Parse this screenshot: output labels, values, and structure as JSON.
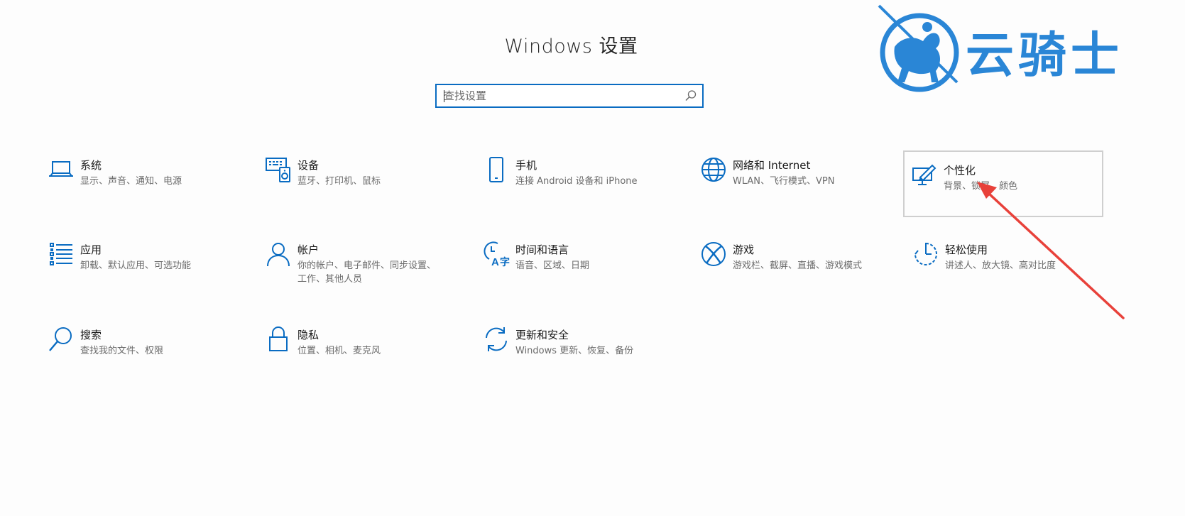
{
  "page": {
    "title": "Windows 设置"
  },
  "search": {
    "placeholder": "查找设置",
    "icon": "search-icon"
  },
  "tiles": [
    {
      "key": "system",
      "icon": "laptop-icon",
      "title": "系统",
      "desc": "显示、声音、通知、电源"
    },
    {
      "key": "devices",
      "icon": "keyboard-speaker-icon",
      "title": "设备",
      "desc": "蓝牙、打印机、鼠标"
    },
    {
      "key": "phone",
      "icon": "phone-icon",
      "title": "手机",
      "desc": "连接 Android 设备和 iPhone"
    },
    {
      "key": "network",
      "icon": "globe-icon",
      "title": "网络和 Internet",
      "desc": "WLAN、飞行模式、VPN"
    },
    {
      "key": "personalization",
      "icon": "monitor-pen-icon",
      "title": "个性化",
      "desc": "背景、锁屏、颜色",
      "selected": true
    },
    {
      "key": "apps",
      "icon": "app-list-icon",
      "title": "应用",
      "desc": "卸载、默认应用、可选功能"
    },
    {
      "key": "accounts",
      "icon": "person-icon",
      "title": "帐户",
      "desc": "你的帐户、电子邮件、同步设置、工作、其他人员"
    },
    {
      "key": "time-language",
      "icon": "clock-language-icon",
      "title": "时间和语言",
      "desc": "语音、区域、日期"
    },
    {
      "key": "gaming",
      "icon": "xbox-icon",
      "title": "游戏",
      "desc": "游戏栏、截屏、直播、游戏模式"
    },
    {
      "key": "ease-of-access",
      "icon": "accessibility-timer-icon",
      "title": "轻松使用",
      "desc": "讲述人、放大镜、高对比度"
    },
    {
      "key": "search",
      "icon": "magnifier-icon",
      "title": "搜索",
      "desc": "查找我的文件、权限"
    },
    {
      "key": "privacy",
      "icon": "lock-icon",
      "title": "隐私",
      "desc": "位置、相机、麦克风"
    },
    {
      "key": "update-security",
      "icon": "sync-arrows-icon",
      "title": "更新和安全",
      "desc": "Windows 更新、恢复、备份"
    }
  ],
  "watermark": {
    "logo": "knight-horse-logo",
    "text": "云骑士"
  },
  "annotation": {
    "type": "red-arrow-pointing-to-personalization"
  },
  "colors": {
    "accent": "#0a6cc2",
    "watermark": "#2a86d6",
    "arrow": "#e8413a"
  }
}
